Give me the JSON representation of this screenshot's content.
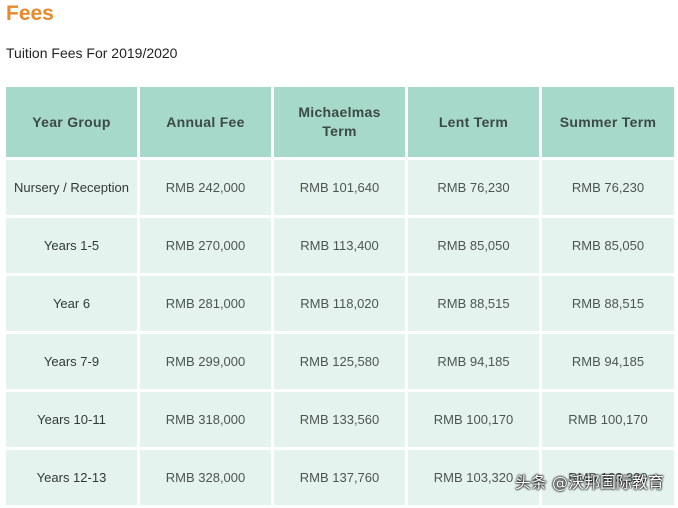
{
  "heading": "Fees",
  "subheading": "Tuition Fees For 2019/2020",
  "table": {
    "headers": [
      "Year Group",
      "Annual Fee",
      "Michaelmas Term",
      "Lent Term",
      "Summer Term"
    ],
    "rows": [
      [
        "Nursery / Reception",
        "RMB 242,000",
        "RMB 101,640",
        "RMB 76,230",
        "RMB 76,230"
      ],
      [
        "Years 1-5",
        "RMB 270,000",
        "RMB 113,400",
        "RMB 85,050",
        "RMB 85,050"
      ],
      [
        "Year 6",
        "RMB 281,000",
        "RMB 118,020",
        "RMB 88,515",
        "RMB 88,515"
      ],
      [
        "Years 7-9",
        "RMB 299,000",
        "RMB 125,580",
        "RMB 94,185",
        "RMB 94,185"
      ],
      [
        "Years 10-11",
        "RMB 318,000",
        "RMB 133,560",
        "RMB 100,170",
        "RMB 100,170"
      ],
      [
        "Years 12-13",
        "RMB 328,000",
        "RMB 137,760",
        "RMB 103,320",
        "RMB 103,320"
      ]
    ]
  },
  "watermark": "头条 @沃邦国际教育",
  "colors": {
    "heading": "#e8892b",
    "header_bg": "#a6d9c9",
    "cell_bg": "#e5f3ee"
  }
}
